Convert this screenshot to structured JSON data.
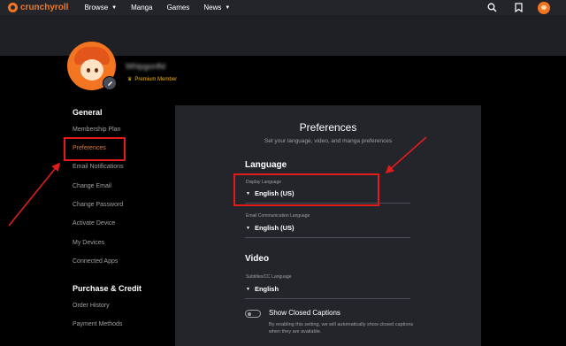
{
  "header": {
    "logo_text": "crunchyroll",
    "nav": [
      {
        "label": "Browse",
        "caret": "▼"
      },
      {
        "label": "Manga"
      },
      {
        "label": "Games"
      },
      {
        "label": "News",
        "caret": "▼"
      }
    ],
    "icons": [
      "search-icon",
      "bookmark-icon",
      "avatar"
    ]
  },
  "profile": {
    "username": "Whlpgonfld",
    "badge": "Premium Member",
    "badge_icon": "crown-icon"
  },
  "sidebar": {
    "general_heading": "General",
    "general_items": [
      {
        "label": "Membership Plan"
      },
      {
        "label": "Preferences",
        "active": true
      },
      {
        "label": "Email Notifications"
      },
      {
        "label": "Change Email"
      },
      {
        "label": "Change Password"
      },
      {
        "label": "Activate Device"
      },
      {
        "label": "My Devices"
      },
      {
        "label": "Connected Apps"
      }
    ],
    "purchase_heading": "Purchase & Credit",
    "purchase_items": [
      {
        "label": "Order History"
      },
      {
        "label": "Payment Methods"
      }
    ]
  },
  "panel": {
    "title": "Preferences",
    "subtitle": "Set your language, video, and manga preferences",
    "language_heading": "Language",
    "display_language_label": "Display Language",
    "display_language_value": "English (US)",
    "email_language_label": "Email Communication Language",
    "email_language_value": "English (US)",
    "video_heading": "Video",
    "subtitles_label": "Subtitles/CC Language",
    "subtitles_value": "English",
    "closed_captions_label": "Show Closed Captions",
    "closed_captions_desc": "By enabling this setting, we will automatically show closed captions when they are available.",
    "closed_captions_on": false
  },
  "colors": {
    "brand": "#f47521",
    "annotation": "#e21b1b",
    "panel": "#23252b",
    "premium": "#f8b500"
  }
}
